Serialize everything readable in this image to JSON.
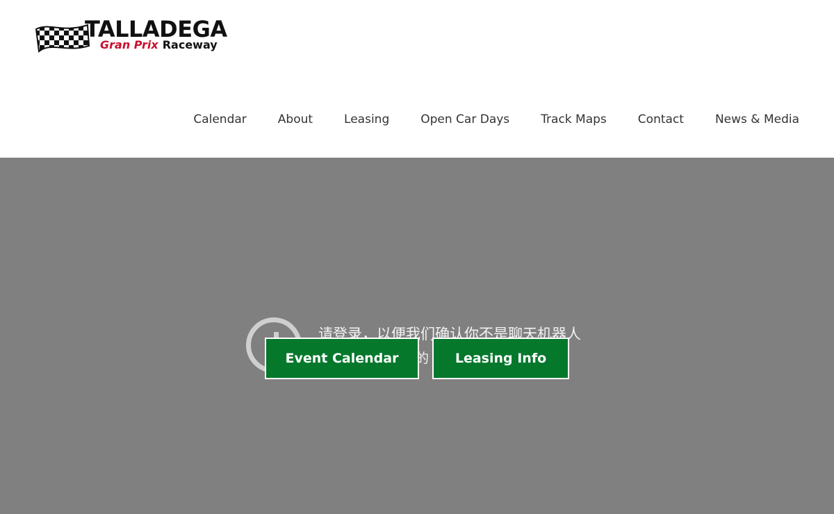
{
  "logo": {
    "title": "TALLADEGA",
    "subtitle_red": "Gran Prix",
    "subtitle_black": "Raceway"
  },
  "nav": {
    "items": [
      {
        "label": "Calendar"
      },
      {
        "label": "About"
      },
      {
        "label": "Leasing"
      },
      {
        "label": "Open Car Days"
      },
      {
        "label": "Track Maps"
      },
      {
        "label": "Contact"
      },
      {
        "label": "News & Media"
      }
    ]
  },
  "hero": {
    "captcha_line1": "请登录，以便我们确认你不是聊天机器人",
    "captcha_line2": "的",
    "buttons": {
      "event_calendar": "Event Calendar",
      "leasing_info": "Leasing Info"
    }
  },
  "colors": {
    "hero_background": "#808080",
    "button_green": "#05782c",
    "logo_red": "#c8102e",
    "nav_text": "#333333"
  }
}
